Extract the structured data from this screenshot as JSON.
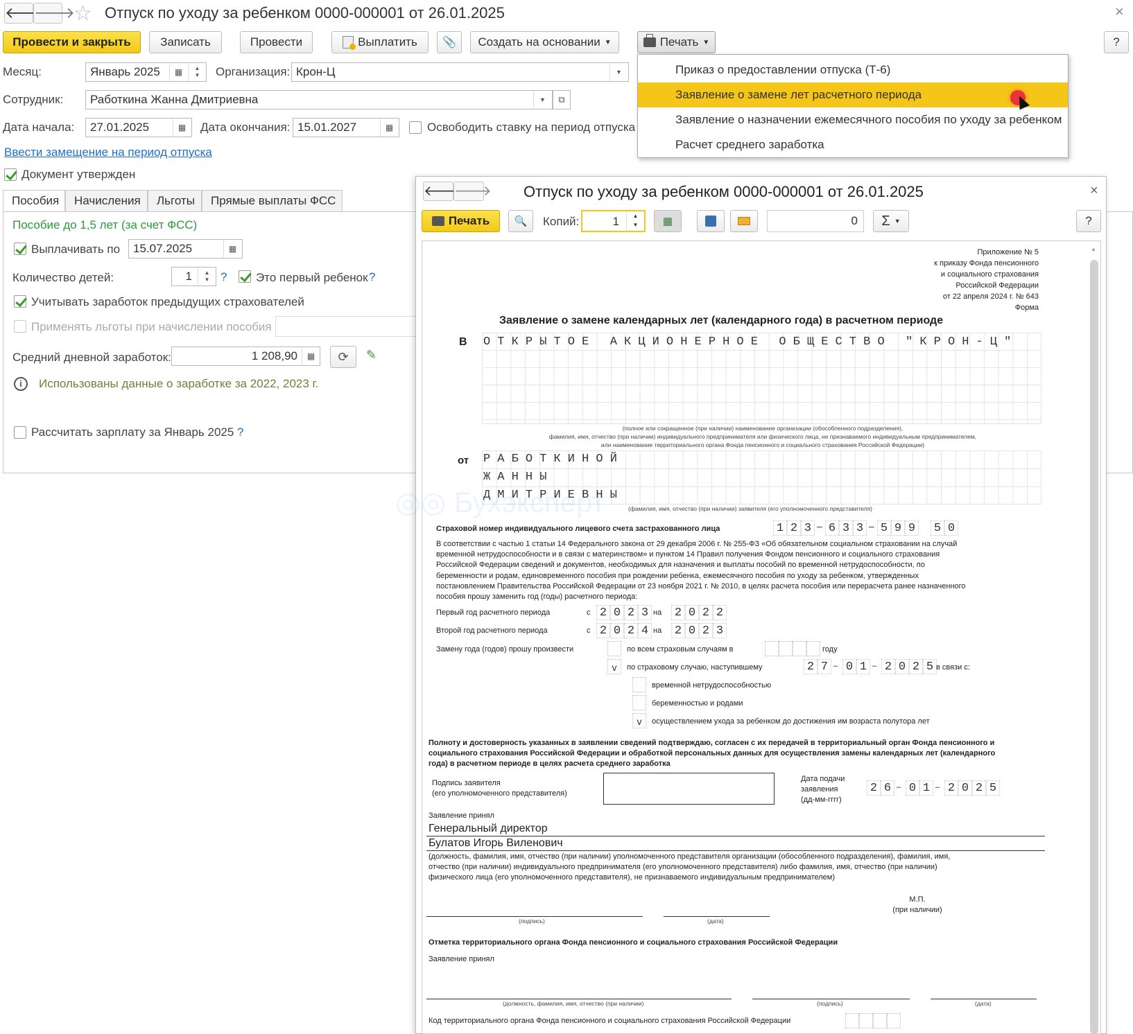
{
  "window": {
    "title": "Отпуск по уходу за ребенком 0000-000001 от 26.01.2025"
  },
  "toolbar": {
    "post_close": "Провести и закрыть",
    "save": "Записать",
    "post": "Провести",
    "pay": "Выплатить",
    "create_based": "Создать на основании",
    "print": "Печать",
    "help": "?"
  },
  "print_menu": [
    {
      "label": "Приказ о предоставлении отпуска (Т-6)"
    },
    {
      "label": "Заявление о замене лет расчетного периода"
    },
    {
      "label": "Заявление о назначении ежемесячного пособия по уходу за ребенком"
    },
    {
      "label": "Расчет среднего заработка"
    }
  ],
  "form": {
    "month_label": "Месяц:",
    "month_value": "Январь 2025",
    "org_label": "Организация:",
    "org_value": "Крон-Ц",
    "employee_label": "Сотрудник:",
    "employee_value": "Работкина Жанна Дмитриевна",
    "start_label": "Дата начала:",
    "start_value": "27.01.2025",
    "end_label": "Дата окончания:",
    "end_value": "15.01.2027",
    "free_rate": "Освободить ставку на период отпуска",
    "substitution_link": "Ввести замещение на период отпуска",
    "approved": "Документ утвержден",
    "tabs": [
      "Пособия",
      "Начисления",
      "Льготы",
      "Прямые выплаты ФСС"
    ],
    "benefit_title": "Пособие до 1,5 лет (за счет ФСС)",
    "pay_until_label": "Выплачивать по",
    "pay_until_value": "15.07.2025",
    "children_label": "Количество детей:",
    "children_value": "1",
    "first_child": "Это первый ребенок",
    "prev_employers": "Учитывать заработок предыдущих страхователей",
    "apply_benefits": "Применять льготы при начислении пособия",
    "avg_earnings_label": "Средний дневной заработок:",
    "avg_earnings_value": "1 208,90",
    "info_text": "Использованы данные о заработке за  2022,  2023 г.",
    "calc_salary": "Рассчитать зарплату за Январь 2025"
  },
  "preview": {
    "title": "Отпуск по уходу за ребенком 0000-000001 от 26.01.2025",
    "print_btn": "Печать",
    "copies_label": "Копий:",
    "copies_value": "1",
    "sum_value": "0",
    "help": "?",
    "close": "×"
  },
  "doc": {
    "appendix": [
      "Приложение № 5",
      "к приказу Фонда пенсионного",
      "и социального страхования",
      "Российской Федерации",
      "от 22 апреля 2024 г. № 643",
      "Форма"
    ],
    "heading": "Заявление о замене календарных лет (календарного года) в расчетном периоде",
    "to_label": "В",
    "to_value": "ОТКРЫТОЕ АКЦИОНЕРНОЕ ОБЩЕСТВО \"КРОН-Ц\"",
    "to_caption": [
      "(полное или сокращенное (при наличии) наименование организации (обособленного подразделения),",
      "фамилия, имя, отчество (при наличии) индивидуального предпринимателя или физического лица, не признаваемого индивидуальным предпринимателем,",
      "или наименование территориального органа Фонда пенсионного и социального страхования Российской Федерации)"
    ],
    "from_label": "от",
    "from_lines": [
      "РАБОТКИНОЙ",
      "ЖАННЫ",
      "ДМИТРИЕВНЫ"
    ],
    "from_caption": "(фамилия, имя, отчество (при наличии) заявителя (его уполномоченного представителя)",
    "snils_label": "Страховой номер  индивидуального лицевого счета застрахованного лица",
    "snils": [
      "1",
      "2",
      "3",
      "6",
      "3",
      "3",
      "5",
      "9",
      "9",
      "5",
      "0"
    ],
    "body_text": [
      "В соответствии с частью 1 статьи 14 Федерального закона от 29 декабря 2006 г. № 255-ФЗ «Об обязательном социальном страховании на случай",
      "временной нетрудоспособности и в связи с материнством» и пунктом 14 Правил получения Фондом пенсионного и социального страхования",
      "Российской Федерации сведений и документов, необходимых для назначения и выплаты пособий по временной нетрудоспособности, по",
      "беременности и родам, единовременного пособия при рождении ребенка, ежемесячного пособия по уходу за ребенком, утвержденных",
      "постановлением Правительства Российской Федерации от 23 ноября 2021 г. № 2010, в целях расчета пособия или перерасчета ранее назначенного",
      "пособия прошу заменить год (годы) расчетного периода:"
    ],
    "first_year_label": "Первый год расчетного периода",
    "second_year_label": "Второй год расчетного периода",
    "from_prefix": "с",
    "to_prefix": "на",
    "first_from": [
      "2",
      "0",
      "2",
      "3"
    ],
    "first_to": [
      "2",
      "0",
      "2",
      "2"
    ],
    "second_from": [
      "2",
      "0",
      "2",
      "4"
    ],
    "second_to": [
      "2",
      "0",
      "2",
      "3"
    ],
    "replace_label": "Замену года (годов) прошу произвести",
    "all_cases": "по всем страховым случаям в",
    "year_word": "году",
    "insured_case": "по страховому случаю, наступившему",
    "case_mark": "v",
    "case_date": [
      "2",
      "7",
      "0",
      "1",
      "2",
      "0",
      "2",
      "5"
    ],
    "in_connection": "в связи с:",
    "reason1": "временной нетрудоспособностью",
    "reason2": "беременностью и родами",
    "reason3": "осуществлением ухода за ребенком до достижения им возраста полутора лет",
    "reason3_mark": "v",
    "confirm_text": [
      "Полноту и достоверность указанных в заявлении сведений подтверждаю, согласен с их передачей в территориальный орган Фонда пенсионного и",
      "социального страхования Российской Федерации и обработкой персональных данных для осуществления замены календарных лет (календарного",
      "года) в расчетном периоде в целях расчета среднего заработка"
    ],
    "sign_label": [
      "Подпись заявителя",
      "(его уполномоченного представителя)"
    ],
    "date_label": [
      "Дата подачи",
      "заявления",
      "(дд-мм-гггг)"
    ],
    "submit_date": [
      "2",
      "6",
      "0",
      "1",
      "2",
      "0",
      "2",
      "5"
    ],
    "accepted_label": "Заявление принял",
    "accepted_position": "Генеральный директор",
    "accepted_name": "Булатов Игорь Виленович",
    "accepted_caption": [
      "(должность, фамилия, имя, отчество (при наличии) уполномоченного представителя организации (обособленного подразделения), фамилия, имя,",
      "отчество (при наличии) индивидуального предпринимателя (его уполномоченного представителя) либо фамилия, имя, отчество (при наличии)",
      "физического лица (его уполномоченного представителя), не признаваемого индивидуальным предпринимателем)"
    ],
    "signature_cap": "(подпись)",
    "date_cap": "(дата)",
    "stamp": [
      "М.П.",
      "(при наличии)"
    ],
    "fund_mark": "Отметка территориального органа Фонда пенсионного и социального страхования Российской Федерации",
    "accepted_label2": "Заявление принял",
    "fio_cap": "(должность, фамилия, имя, отчество (при наличии)",
    "fund_code": "Код территориального органа Фонда пенсионного и социального страхования Российской Федерации"
  },
  "colors": {
    "accent_yellow": "#f5c518",
    "link_blue": "#1f6fc5",
    "green_text": "#2a9a3a"
  }
}
